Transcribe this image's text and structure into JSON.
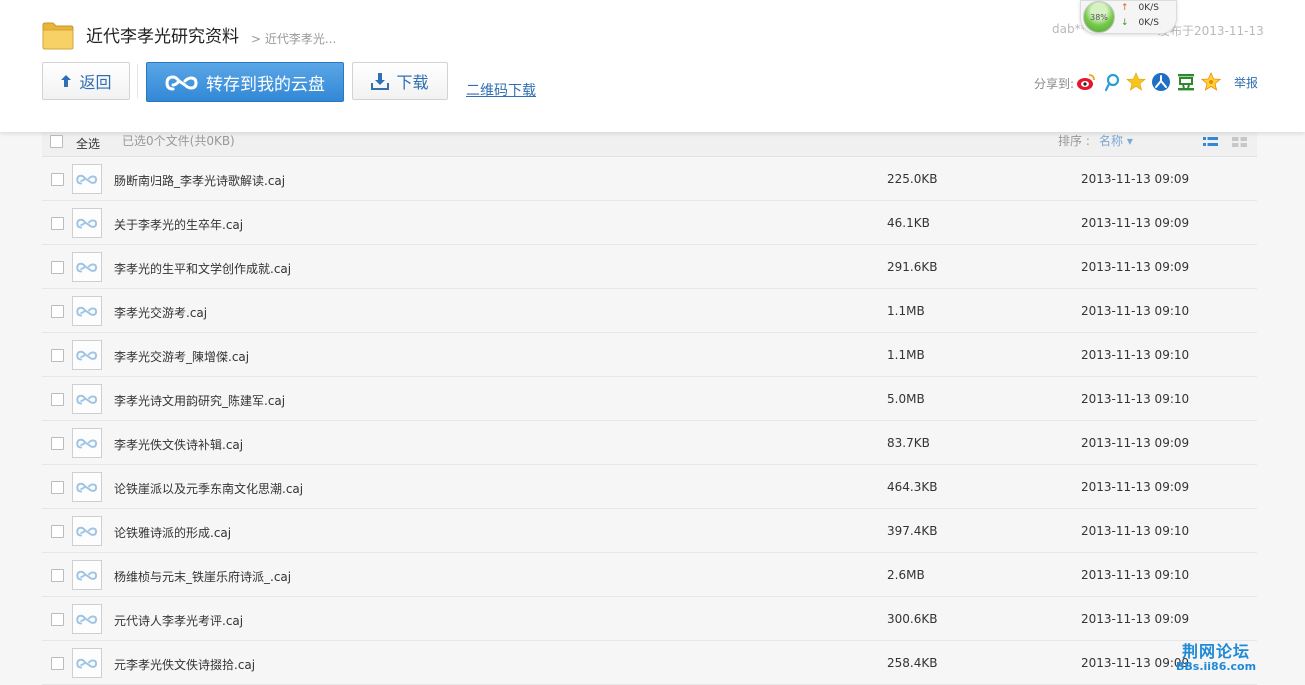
{
  "header": {
    "title": "近代李孝光研究资料",
    "breadcrumb": "> 近代李孝光...",
    "back_label": "返回",
    "save_label": "转存到我的云盘",
    "download_label": "下载",
    "qr_label": "二维码下载",
    "user_name": "dab**",
    "publish_date": "发布于2013-11-13",
    "share_label": "分享到:",
    "report_label": "举报"
  },
  "speed": {
    "percent": "38%",
    "up": "0K/S",
    "down": "0K/S"
  },
  "share_icons": [
    "weibo-icon",
    "tencent-weibo-icon",
    "qzone-icon",
    "renren-icon",
    "douban-icon",
    "kaixin-icon"
  ],
  "list": {
    "select_all": "全选",
    "selected_info": "已选0个文件(共0KB)",
    "sort_label": "排序 :",
    "sort_field": "名称 ▾"
  },
  "files": [
    {
      "name": "肠断南归路_李孝光诗歌解读.caj",
      "size": "225.0KB",
      "date": "2013-11-13 09:09"
    },
    {
      "name": "关于李孝光的生卒年.caj",
      "size": "46.1KB",
      "date": "2013-11-13 09:09"
    },
    {
      "name": "李孝光的生平和文学创作成就.caj",
      "size": "291.6KB",
      "date": "2013-11-13 09:09"
    },
    {
      "name": "李孝光交游考.caj",
      "size": "1.1MB",
      "date": "2013-11-13 09:10"
    },
    {
      "name": "李孝光交游考_陳增傑.caj",
      "size": "1.1MB",
      "date": "2013-11-13 09:10"
    },
    {
      "name": "李孝光诗文用韵研究_陈建军.caj",
      "size": "5.0MB",
      "date": "2013-11-13 09:10"
    },
    {
      "name": "李孝光佚文佚诗补辑.caj",
      "size": "83.7KB",
      "date": "2013-11-13 09:09"
    },
    {
      "name": "论铁崖派以及元季东南文化思潮.caj",
      "size": "464.3KB",
      "date": "2013-11-13 09:09"
    },
    {
      "name": "论铁雅诗派的形成.caj",
      "size": "397.4KB",
      "date": "2013-11-13 09:10"
    },
    {
      "name": "杨维桢与元末_铁崖乐府诗派_.caj",
      "size": "2.6MB",
      "date": "2013-11-13 09:10"
    },
    {
      "name": "元代诗人李孝光考评.caj",
      "size": "300.6KB",
      "date": "2013-11-13 09:09"
    },
    {
      "name": "元李孝光佚文佚诗掇拾.caj",
      "size": "258.4KB",
      "date": "2013-11-13 09:09"
    }
  ],
  "watermark": {
    "main": "荆网论坛",
    "sub": "BBs.ii86.com"
  },
  "colors": {
    "accent": "#3288d6",
    "link": "#2f6fb3"
  }
}
